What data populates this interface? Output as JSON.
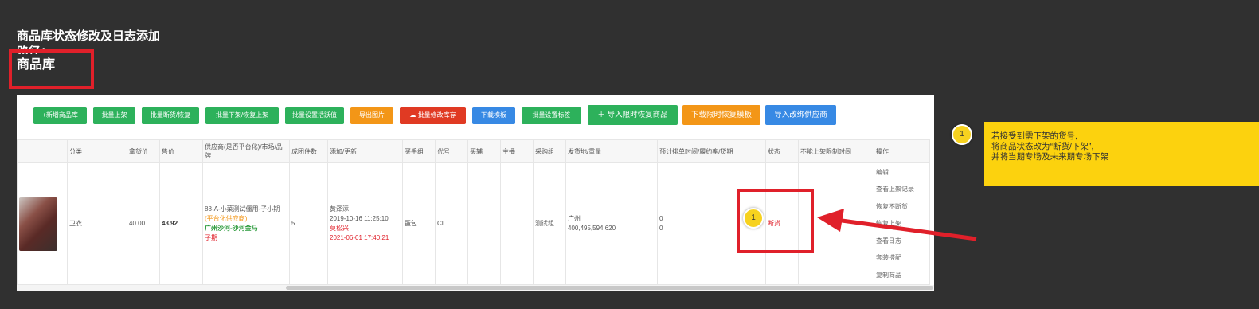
{
  "heading": {
    "title": "商品库状态修改及日志添加",
    "path_label": "路径：",
    "crumb": "商品库"
  },
  "toolbar": {
    "buttons": [
      "+新增商品库",
      "批量上架",
      "批量断货/恢复",
      "批量下架/恢复上架",
      "批量设置活跃值",
      "导出图片",
      "批量修改库存",
      "下载模板",
      "批量设置标签",
      "导入限时恢复商品",
      "下载限时恢复模板",
      "导入改绑供应商"
    ]
  },
  "table": {
    "headers": [
      "",
      "分类",
      "拿货价",
      "售价",
      "供应商(是否平台化)/市场/品牌",
      "成团件数",
      "添加/更新",
      "买手组",
      "代号",
      "买辅",
      "主播",
      "采购组",
      "发货地/重量",
      "预计排单时间/履约率/货期",
      "状态",
      "不能上架限制时间",
      "操作"
    ],
    "row": {
      "category": "卫衣",
      "cost_price": "40.00",
      "sale_price": "43.92",
      "supplier": "88-A-小菜测试僵用-子小期",
      "platform": "(平台化供应商)",
      "market": "广州沙河-沙河金马",
      "brand": "子期",
      "group_qty": "5",
      "added_by": "黄泽添",
      "added_at": "2019-10-16 11:25:10",
      "updated_by": "莫松兴",
      "updated_at": "2021-06-01 17:40:21",
      "buyer_group": "蛋包",
      "code": "CL",
      "assistant": "",
      "anchor": "",
      "purchase_group": "测试组",
      "ship_from": "广州",
      "weight": "400,495,594,620",
      "schedule_1": "0",
      "schedule_2": "0",
      "status": "断货",
      "restrict_time": "",
      "ops": [
        "编辑",
        "查看上架记录",
        "恢复不断货",
        "恢复上架",
        "查看日志",
        "套装搭配",
        "复制商品"
      ]
    }
  },
  "markers": {
    "status_marker": "1",
    "note_marker": "1"
  },
  "note": {
    "line1": "若接受到需下架的货号,",
    "line2": "将商品状态改为“断货/下架”,",
    "line3": "并将当期专场及未来期专场下架"
  },
  "colors": {
    "highlight": "#e0202a",
    "note_bg": "#fcd20e",
    "canvas_bg": "#303030"
  }
}
